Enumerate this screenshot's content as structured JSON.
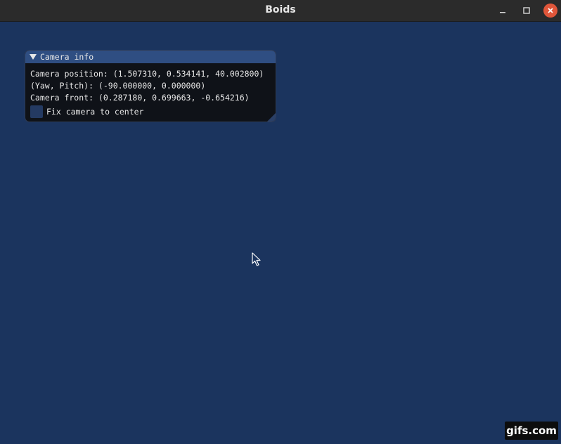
{
  "window": {
    "title": "Boids",
    "controls": {
      "minimize": "minimize-icon",
      "maximize": "maximize-icon",
      "close": "close-icon"
    },
    "background_color": "#1b345e",
    "close_color": "#e0563a"
  },
  "camera_panel": {
    "title": "Camera info",
    "collapse_icon": "triangle-down-icon",
    "position_text": "Camera position: (1.507310, 0.534141, 40.002800)",
    "yaw_pitch_text": "(Yaw, Pitch): (-90.000000, 0.000000)",
    "front_text": "Camera front: (0.287180, 0.699663, -0.654216)",
    "fix_camera": {
      "label": "Fix camera to center",
      "checked": false
    },
    "header_color": "#2f4e82",
    "body_color": "#0f1218"
  },
  "watermark": {
    "text": "gifs.com"
  }
}
